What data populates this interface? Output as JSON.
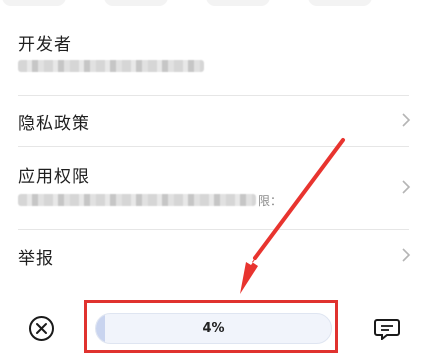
{
  "rows": [
    {
      "title": "开发者"
    },
    {
      "title": "隐私政策"
    },
    {
      "title": "应用权限",
      "sub_tail": "限："
    },
    {
      "title": "举报"
    }
  ],
  "bottom": {
    "progress_label": "4%",
    "progress_value": 0.04
  },
  "colors": {
    "highlight": "#e0322f",
    "arrow": "#e8342f"
  },
  "icons": {
    "close": "close-circle-icon",
    "feedback": "feedback-icon",
    "chevron": "chevron-right-icon"
  }
}
